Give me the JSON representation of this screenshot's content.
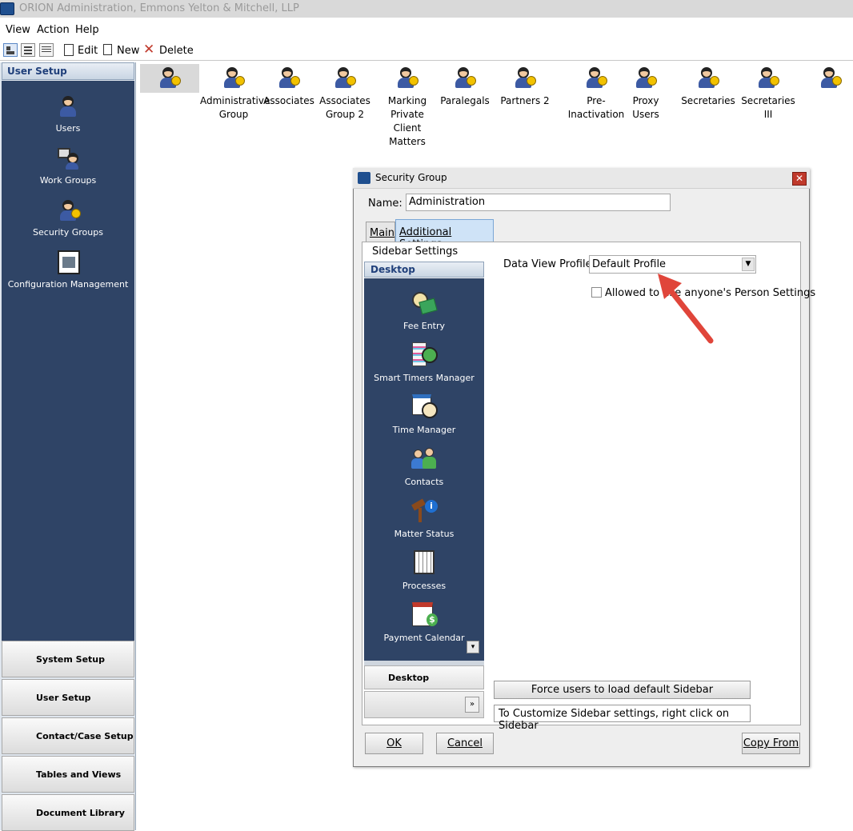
{
  "window": {
    "title": "ORION Administration, Emmons Yelton & Mitchell, LLP"
  },
  "menu": [
    "View",
    "Action",
    "Help"
  ],
  "toolbar": {
    "edit": "Edit",
    "new": "New",
    "delete": "Delete"
  },
  "left_nav": {
    "header": "User Setup",
    "items": [
      "Users",
      "Work Groups",
      "Security Groups",
      "Configuration Management"
    ],
    "buttons": [
      "System Setup",
      "User Setup",
      "Contact/Case Setup",
      "Tables and Views",
      "Document Library"
    ]
  },
  "groups": [
    {
      "label": ""
    },
    {
      "label": "Administrative Group"
    },
    {
      "label": "Associates"
    },
    {
      "label": "Associates Group 2"
    },
    {
      "label": "Marking Private Client Matters"
    },
    {
      "label": "Paralegals"
    },
    {
      "label": "Partners 2"
    },
    {
      "label": "Pre-Inactivation"
    },
    {
      "label": "Proxy Users"
    },
    {
      "label": "Secretaries"
    },
    {
      "label": "Secretaries III"
    },
    {
      "label": ""
    }
  ],
  "dialog": {
    "title": "Security Group",
    "name_label": "Name:",
    "name_value": "Administration",
    "tabs": [
      "Main",
      "Additional Settings"
    ],
    "sidebar_settings_label": "Sidebar Settings",
    "sidebar_header": "Desktop",
    "sidebar_items": [
      "Fee Entry",
      "Smart Timers Manager",
      "Time Manager",
      "Contacts",
      "Matter Status",
      "Processes",
      "Payment Calendar"
    ],
    "sidebar_desktop_button": "Desktop",
    "data_view_profile_label": "Data View Profile",
    "data_view_profile_value": "Default Profile",
    "allow_label": "Allowed to use anyone's Person Settings",
    "force_button": "Force users to load default Sidebar",
    "customize_note": "To Customize Sidebar settings, right click on  Sidebar",
    "ok": "OK",
    "cancel": "Cancel",
    "copy_from": "Copy From"
  }
}
